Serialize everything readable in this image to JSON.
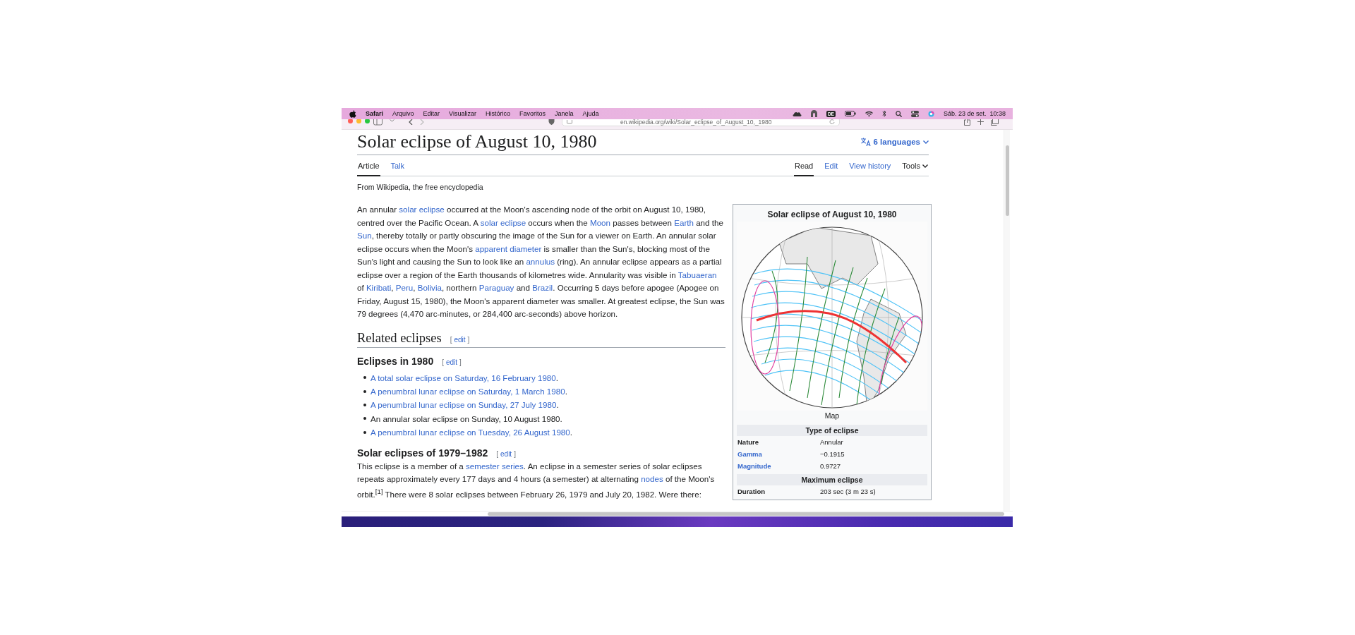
{
  "menu_bar": {
    "app": "Safari",
    "menus": [
      "Arquivo",
      "Editar",
      "Visualizar",
      "Histórico",
      "Favoritos",
      "Janela",
      "Ajuda"
    ],
    "input_source": "DE",
    "clock": "Sáb. 23 de set.  10:38"
  },
  "toolbar": {
    "url": "en.wikipedia.org/wiki/Solar_eclipse_of_August_10,_1980"
  },
  "article": {
    "title": "Solar eclipse of August 10, 1980",
    "languages": "6 languages",
    "tabs_left": [
      {
        "label": "Article",
        "selected": true
      },
      {
        "label": "Talk",
        "selected": false
      }
    ],
    "tabs_right": [
      {
        "label": "Read",
        "selected": true,
        "kind": "tab"
      },
      {
        "label": "Edit",
        "selected": false,
        "kind": "tab"
      },
      {
        "label": "View history",
        "selected": false,
        "kind": "tab"
      },
      {
        "label": "Tools",
        "selected": false,
        "kind": "menu"
      }
    ],
    "tagline": "From Wikipedia, the free encyclopedia",
    "blocks": [
      {
        "kind": "paragraph",
        "segments": [
          {
            "text": "An annular ",
            "link": false
          },
          {
            "text": "solar eclipse",
            "link": true
          },
          {
            "text": " occurred at the Moon's ascending node of the orbit on August 10, 1980, centred over the Pacific Ocean. A ",
            "link": false
          },
          {
            "text": "solar eclipse",
            "link": true
          },
          {
            "text": " occurs when the ",
            "link": false
          },
          {
            "text": "Moon",
            "link": true
          },
          {
            "text": " passes between ",
            "link": false
          },
          {
            "text": "Earth",
            "link": true
          },
          {
            "text": " and the ",
            "link": false
          },
          {
            "text": "Sun",
            "link": true
          },
          {
            "text": ", thereby totally or partly obscuring the image of the Sun for a viewer on Earth. An annular solar eclipse occurs when the Moon's ",
            "link": false
          },
          {
            "text": "apparent diameter",
            "link": true
          },
          {
            "text": " is smaller than the Sun's, blocking most of the Sun's light and causing the Sun to look like an ",
            "link": false
          },
          {
            "text": "annulus",
            "link": true
          },
          {
            "text": " (ring). An annular eclipse appears as a partial eclipse over a region of the Earth thousands of kilometres wide. Annularity was visible in ",
            "link": false
          },
          {
            "text": "Tabuaeran",
            "link": true
          },
          {
            "text": " of ",
            "link": false
          },
          {
            "text": "Kiribati",
            "link": true
          },
          {
            "text": ", ",
            "link": false
          },
          {
            "text": "Peru",
            "link": true
          },
          {
            "text": ", ",
            "link": false
          },
          {
            "text": "Bolivia",
            "link": true
          },
          {
            "text": ", northern ",
            "link": false
          },
          {
            "text": "Paraguay",
            "link": true
          },
          {
            "text": " and ",
            "link": false
          },
          {
            "text": "Brazil",
            "link": true
          },
          {
            "text": ". Occurring 5 days before apogee (Apogee on Friday, August 15, 1980), the Moon's apparent diameter was smaller. At greatest eclipse, the Sun was 79 degrees (4,470 arc-minutes, or 284,400 arc-seconds) above horizon.",
            "link": false
          }
        ]
      },
      {
        "kind": "h2",
        "text": "Related eclipses",
        "edit": "edit",
        "brackets": [
          "[",
          "]"
        ]
      },
      {
        "kind": "h3",
        "text": "Eclipses in 1980",
        "edit": "edit",
        "brackets": [
          "[",
          "]"
        ]
      },
      {
        "kind": "list",
        "items": [
          {
            "segments": [
              {
                "text": "A total solar eclipse on Saturday, 16 February 1980",
                "link": true
              },
              {
                "text": ".",
                "link": false
              }
            ]
          },
          {
            "segments": [
              {
                "text": "A penumbral lunar eclipse on Saturday, 1 March 1980",
                "link": true
              },
              {
                "text": ".",
                "link": false
              }
            ]
          },
          {
            "segments": [
              {
                "text": "A penumbral lunar eclipse on Sunday, 27 July 1980",
                "link": true
              },
              {
                "text": ".",
                "link": false
              }
            ]
          },
          {
            "segments": [
              {
                "text": "An annular solar eclipse on Sunday, 10 August 1980.",
                "link": false
              }
            ]
          },
          {
            "segments": [
              {
                "text": "A penumbral lunar eclipse on Tuesday, 26 August 1980",
                "link": true
              },
              {
                "text": ".",
                "link": false
              }
            ]
          }
        ]
      },
      {
        "kind": "h3",
        "text": "Solar eclipses of 1979–1982",
        "edit": "edit",
        "brackets": [
          "[",
          "]"
        ]
      },
      {
        "kind": "paragraph",
        "segments": [
          {
            "text": "This eclipse is a member of a ",
            "link": false
          },
          {
            "text": "semester series",
            "link": true
          },
          {
            "text": ". An eclipse in a semester series of solar eclipses repeats approximately every 177 days and 4 hours (a semester) at alternating ",
            "link": false
          },
          {
            "text": "nodes",
            "link": true
          },
          {
            "text": " of the Moon's orbit.$^{[1]}$ There were 8 solar eclipses between February 26, 1979 and July 20, 1982. Were there:",
            "link": false
          }
        ]
      }
    ]
  },
  "infobox": {
    "title": "Solar eclipse of August 10, 1980",
    "map_caption": "Map",
    "sections": [
      {
        "heading": "Type of eclipse",
        "rows": [
          {
            "label": "Nature",
            "value": "Annular",
            "link": false
          },
          {
            "label": "Gamma",
            "value": "−0.1915",
            "link": true
          },
          {
            "label": "Magnitude",
            "value": "0.9727",
            "link": true
          }
        ]
      },
      {
        "heading": "Maximum eclipse",
        "rows": [
          {
            "label": "Duration",
            "value": "203 sec (3 m 23 s)",
            "link": false
          }
        ]
      }
    ]
  }
}
